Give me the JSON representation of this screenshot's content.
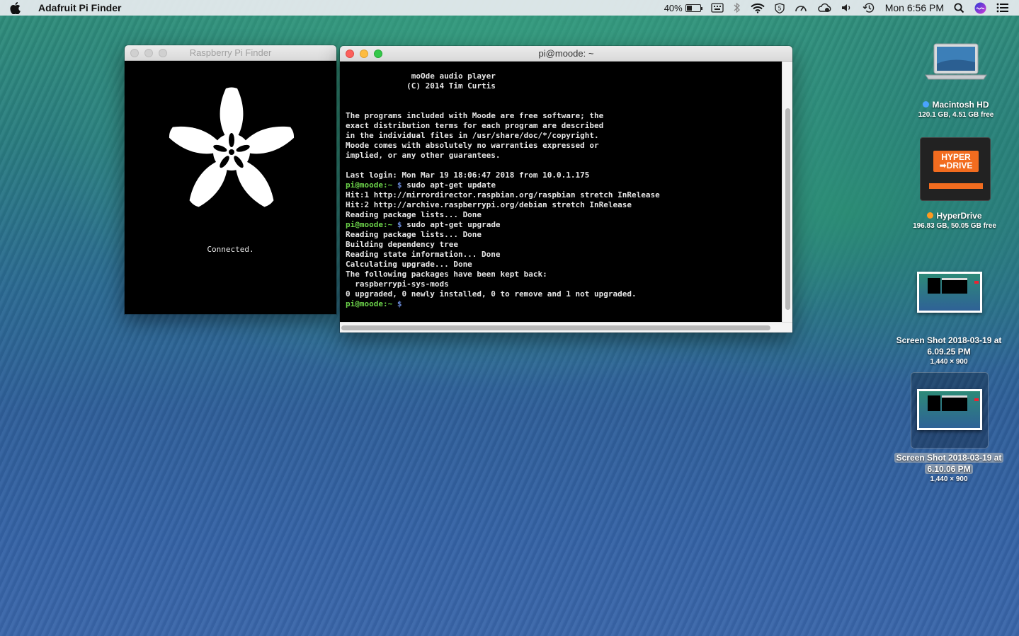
{
  "menubar": {
    "app_name": "Adafruit Pi Finder",
    "battery_percent": "40%",
    "clock": "Mon 6:56 PM"
  },
  "finder_window": {
    "title": "Raspberry Pi Finder",
    "status": "Connected."
  },
  "terminal_window": {
    "title": "pi@moode: ~",
    "lines": [
      {
        "text": "              moOde audio player"
      },
      {
        "text": "             (C) 2014 Tim Curtis"
      },
      {
        "text": ""
      },
      {
        "text": ""
      },
      {
        "text": "The programs included with Moode are free software; the"
      },
      {
        "text": "exact distribution terms for each program are described"
      },
      {
        "text": "in the individual files in /usr/share/doc/*/copyright."
      },
      {
        "text": "Moode comes with absolutely no warranties expressed or"
      },
      {
        "text": "implied, or any other guarantees."
      },
      {
        "text": ""
      },
      {
        "text": "Last login: Mon Mar 19 18:06:47 2018 from 10.0.1.175"
      },
      {
        "prompt": "pi@moode",
        "path": ":~ ",
        "dollar": "$",
        "text": " sudo apt-get update"
      },
      {
        "text": "Hit:1 http://mirrordirector.raspbian.org/raspbian stretch InRelease"
      },
      {
        "text": "Hit:2 http://archive.raspberrypi.org/debian stretch InRelease"
      },
      {
        "text": "Reading package lists... Done"
      },
      {
        "prompt": "pi@moode",
        "path": ":~ ",
        "dollar": "$",
        "text": " sudo apt-get upgrade"
      },
      {
        "text": "Reading package lists... Done"
      },
      {
        "text": "Building dependency tree"
      },
      {
        "text": "Reading state information... Done"
      },
      {
        "text": "Calculating upgrade... Done"
      },
      {
        "text": "The following packages have been kept back:"
      },
      {
        "text": "  raspberrypi-sys-mods"
      },
      {
        "text": "0 upgraded, 0 newly installed, 0 to remove and 1 not upgraded."
      },
      {
        "prompt": "pi@moode",
        "path": ":~ ",
        "dollar": "$",
        "text": ""
      }
    ]
  },
  "desktop": {
    "macintosh_hd": {
      "name": "Macintosh HD",
      "info": "120.1 GB, 4.51 GB free",
      "dot_color": "#4aa3ff"
    },
    "hyperdrive": {
      "name": "HyperDrive",
      "info": "196.83 GB, 50.05 GB free",
      "dot_color": "#ff9a1f",
      "logo_line1": "HYPER",
      "logo_line2": "➡DRIVE"
    },
    "screenshot_1": {
      "name_line1": "Screen Shot 2018-03-19 at",
      "name_line2": "6.09.25 PM",
      "info": "1,440 × 900"
    },
    "screenshot_2": {
      "name_line1": "Screen Shot 2018-03-19 at",
      "name_line2": "6.10.06 PM",
      "info": "1,440 × 900"
    }
  }
}
